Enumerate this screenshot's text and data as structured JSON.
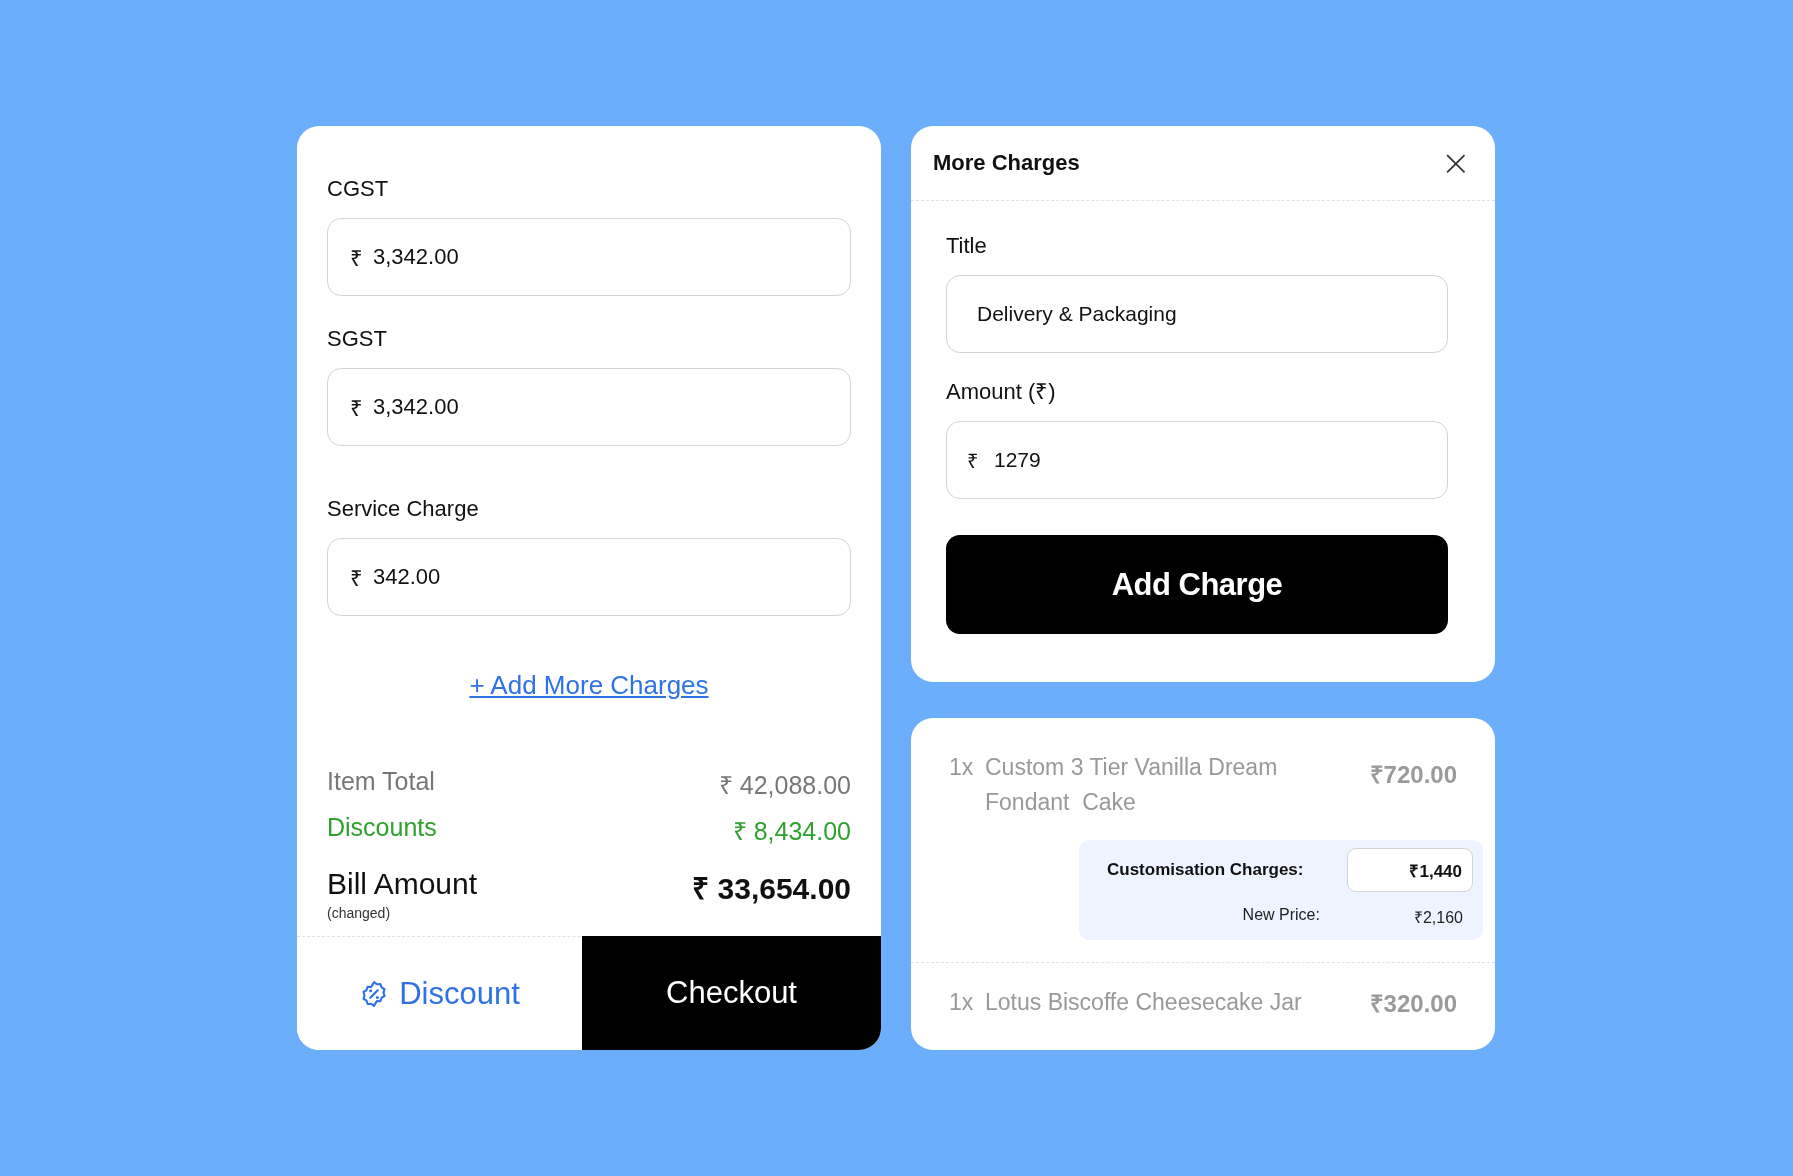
{
  "bill_panel": {
    "fields": [
      {
        "label": "CGST",
        "prefix": "₹",
        "value": "3,342.00"
      },
      {
        "label": "SGST",
        "prefix": "₹",
        "value": "3,342.00"
      },
      {
        "label": "Service Charge",
        "prefix": "₹",
        "value": "342.00"
      }
    ],
    "add_link": "+ Add More Charges",
    "summary": [
      {
        "kind": "plain",
        "label": "Item Total",
        "value": "₹ 42,088.00"
      },
      {
        "kind": "discount",
        "label": "Discounts",
        "value": "₹ 8,434.00"
      },
      {
        "kind": "total",
        "label": "Bill Amount",
        "note": "(changed)",
        "value": "₹ 33,654.00"
      }
    ],
    "discount_button": "Discount",
    "checkout_button": "Checkout"
  },
  "charge_dialog": {
    "title": "More Charges",
    "close": "×",
    "title_field": {
      "label": "Title",
      "value": "Delivery & Packaging"
    },
    "amount_field": {
      "label": "Amount (₹)",
      "prefix": "₹",
      "value": "1279"
    },
    "submit": "Add Charge"
  },
  "order_items": [
    {
      "qty": "1x",
      "name": "Custom 3 Tier Vanilla Dream Fondant  Cake",
      "price": "₹720.00",
      "customisation": {
        "label": "Customisation Charges:",
        "value": "₹1,440",
        "new_price_label": "New Price:",
        "new_price": "₹2,160"
      }
    },
    {
      "qty": "1x",
      "name": "Lotus Biscoffe Cheesecake Jar",
      "price": "₹320.00"
    }
  ]
}
